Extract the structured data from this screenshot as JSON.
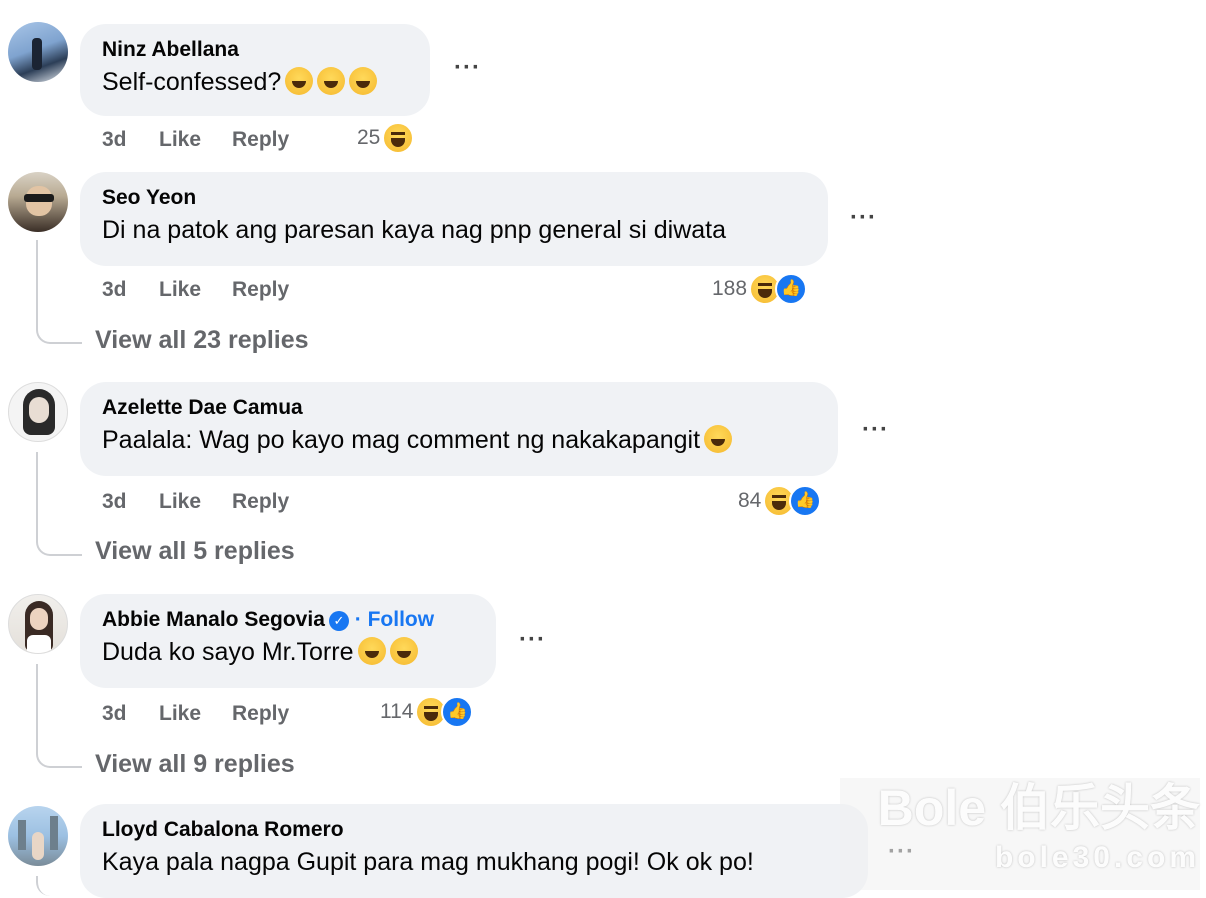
{
  "comments": [
    {
      "name": "Ninz Abellana",
      "text": "Self-confessed?",
      "time": "3d",
      "like": "Like",
      "reply": "Reply",
      "reaction_count": "25"
    },
    {
      "name": "Seo Yeon",
      "text": "Di na patok ang paresan kaya nag pnp general si diwata",
      "time": "3d",
      "like": "Like",
      "reply": "Reply",
      "reaction_count": "188",
      "view_replies": "View all 23 replies"
    },
    {
      "name": "Azelette Dae Camua",
      "text": "Paalala: Wag po kayo mag comment ng nakakapangit",
      "time": "3d",
      "like": "Like",
      "reply": "Reply",
      "reaction_count": "84",
      "view_replies": "View all 5 replies"
    },
    {
      "name": "Abbie Manalo Segovia",
      "follow_sep": "·",
      "follow": "Follow",
      "text": "Duda ko sayo Mr.Torre",
      "time": "3d",
      "like": "Like",
      "reply": "Reply",
      "reaction_count": "114",
      "view_replies": "View all 9 replies"
    },
    {
      "name": "Lloyd Cabalona Romero",
      "text": "Kaya pala nagpa Gupit para mag mukhang pogi! Ok ok po!"
    }
  ],
  "more_label": "···",
  "watermark": {
    "line1": "Bole 伯乐头条",
    "line2": "bole30.com"
  },
  "colors": {
    "bubble": "#f0f2f5",
    "meta": "#65676b",
    "link": "#1877f2"
  }
}
